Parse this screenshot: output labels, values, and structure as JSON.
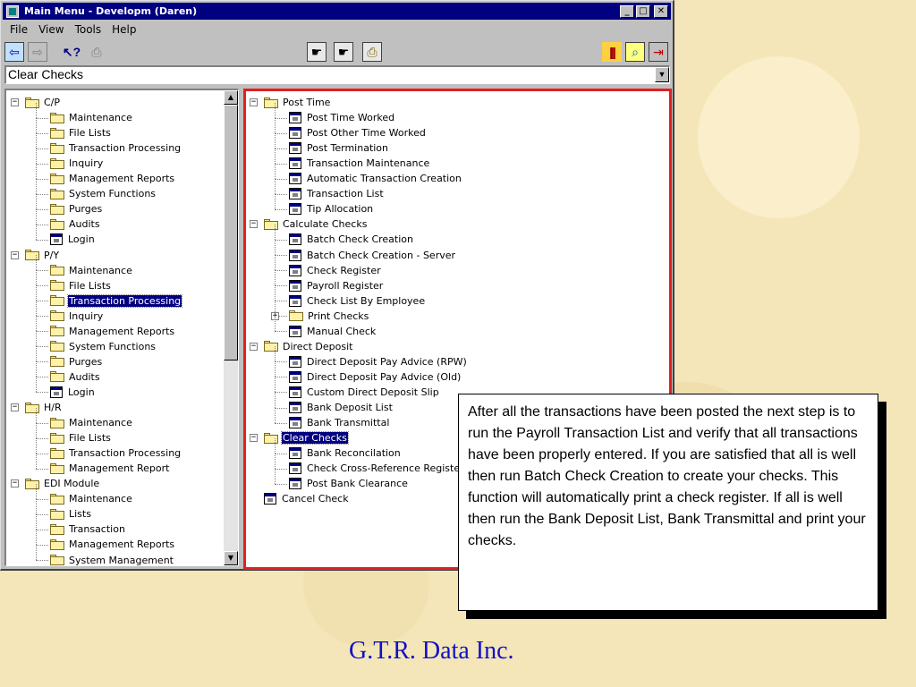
{
  "window": {
    "title": "Main Menu - Developm (Daren)"
  },
  "menu": [
    "File",
    "View",
    "Tools",
    "Help"
  ],
  "toolbar": {
    "left_icons": [
      "back-arrow-icon",
      "forward-arrow-icon",
      "help-pointer-icon",
      "print-icon"
    ],
    "center_icons": [
      "hand-report-icon",
      "hand-menu-icon",
      "printer-queue-icon"
    ],
    "right_icons": [
      "books-icon",
      "find-icon",
      "exit-icon"
    ]
  },
  "combo": {
    "value": "Clear Checks"
  },
  "left_tree": [
    {
      "label": "C/P",
      "type": "folder",
      "level": 0,
      "expand": "minus"
    },
    {
      "label": "Maintenance",
      "type": "folder",
      "level": 1
    },
    {
      "label": "File Lists",
      "type": "folder",
      "level": 1
    },
    {
      "label": "Transaction Processing",
      "type": "folder",
      "level": 1
    },
    {
      "label": "Inquiry",
      "type": "folder",
      "level": 1
    },
    {
      "label": "Management Reports",
      "type": "folder",
      "level": 1
    },
    {
      "label": "System Functions",
      "type": "folder",
      "level": 1
    },
    {
      "label": "Purges",
      "type": "folder",
      "level": 1
    },
    {
      "label": "Audits",
      "type": "folder",
      "level": 1
    },
    {
      "label": "Login",
      "type": "program",
      "level": 1
    },
    {
      "label": "P/Y",
      "type": "folder",
      "level": 0,
      "expand": "minus"
    },
    {
      "label": "Maintenance",
      "type": "folder",
      "level": 1
    },
    {
      "label": "File Lists",
      "type": "folder",
      "level": 1
    },
    {
      "label": "Transaction Processing",
      "type": "folder",
      "level": 1,
      "selected": true
    },
    {
      "label": "Inquiry",
      "type": "folder",
      "level": 1
    },
    {
      "label": "Management Reports",
      "type": "folder",
      "level": 1
    },
    {
      "label": "System Functions",
      "type": "folder",
      "level": 1
    },
    {
      "label": "Purges",
      "type": "folder",
      "level": 1
    },
    {
      "label": "Audits",
      "type": "folder",
      "level": 1
    },
    {
      "label": "Login",
      "type": "program",
      "level": 1
    },
    {
      "label": "H/R",
      "type": "folder",
      "level": 0,
      "expand": "minus"
    },
    {
      "label": "Maintenance",
      "type": "folder",
      "level": 1
    },
    {
      "label": "File Lists",
      "type": "folder",
      "level": 1
    },
    {
      "label": "Transaction Processing",
      "type": "folder",
      "level": 1
    },
    {
      "label": "Management Report",
      "type": "folder",
      "level": 1
    },
    {
      "label": "EDI Module",
      "type": "folder",
      "level": 0,
      "expand": "minus"
    },
    {
      "label": "Maintenance",
      "type": "folder",
      "level": 1
    },
    {
      "label": "Lists",
      "type": "folder",
      "level": 1
    },
    {
      "label": "Transaction",
      "type": "folder",
      "level": 1
    },
    {
      "label": "Management Reports",
      "type": "folder",
      "level": 1
    },
    {
      "label": "System Management",
      "type": "folder",
      "level": 1
    }
  ],
  "right_tree": [
    {
      "label": "Post Time",
      "type": "folder",
      "level": 0,
      "expand": "minus"
    },
    {
      "label": "Post Time Worked",
      "type": "program",
      "level": 1
    },
    {
      "label": "Post Other Time Worked",
      "type": "program",
      "level": 1
    },
    {
      "label": "Post Termination",
      "type": "program",
      "level": 1
    },
    {
      "label": "Transaction Maintenance",
      "type": "program",
      "level": 1
    },
    {
      "label": "Automatic Transaction Creation",
      "type": "program",
      "level": 1
    },
    {
      "label": "Transaction List",
      "type": "program",
      "level": 1
    },
    {
      "label": "Tip Allocation",
      "type": "program",
      "level": 1
    },
    {
      "label": "Calculate Checks",
      "type": "folder",
      "level": 0,
      "expand": "minus"
    },
    {
      "label": "Batch Check Creation",
      "type": "program",
      "level": 1
    },
    {
      "label": "Batch Check Creation - Server",
      "type": "program",
      "level": 1
    },
    {
      "label": "Check Register",
      "type": "program",
      "level": 1
    },
    {
      "label": "Payroll Register",
      "type": "program",
      "level": 1
    },
    {
      "label": "Check List By Employee",
      "type": "program",
      "level": 1
    },
    {
      "label": "Print Checks",
      "type": "folder",
      "level": 1,
      "expand": "plus"
    },
    {
      "label": "Manual Check",
      "type": "program",
      "level": 1
    },
    {
      "label": "Direct Deposit",
      "type": "folder",
      "level": 0,
      "expand": "minus"
    },
    {
      "label": "Direct Deposit Pay Advice (RPW)",
      "type": "program",
      "level": 1
    },
    {
      "label": "Direct Deposit Pay Advice (Old)",
      "type": "program",
      "level": 1
    },
    {
      "label": "Custom Direct Deposit Slip",
      "type": "program",
      "level": 1
    },
    {
      "label": "Bank Deposit List",
      "type": "program",
      "level": 1
    },
    {
      "label": "Bank Transmittal",
      "type": "program",
      "level": 1
    },
    {
      "label": "Clear Checks",
      "type": "folder",
      "level": 0,
      "expand": "minus",
      "selected": true
    },
    {
      "label": "Bank Reconcilation",
      "type": "program",
      "level": 1
    },
    {
      "label": "Check Cross-Reference Register",
      "type": "program",
      "level": 1
    },
    {
      "label": "Post Bank Clearance",
      "type": "program",
      "level": 1
    },
    {
      "label": "Cancel Check",
      "type": "program",
      "level": 0
    }
  ],
  "callout": {
    "text": "After all the transactions have been posted the next step is to run the Payroll Transaction List  and verify that all transactions have been properly entered.  If you are satisfied that all is well then run Batch Check Creation to create your checks.  This function will automatically print a check register.  If all is well then run the Bank Deposit List, Bank Transmittal and print your checks."
  },
  "footer": {
    "text": "G.T.R. Data Inc."
  }
}
